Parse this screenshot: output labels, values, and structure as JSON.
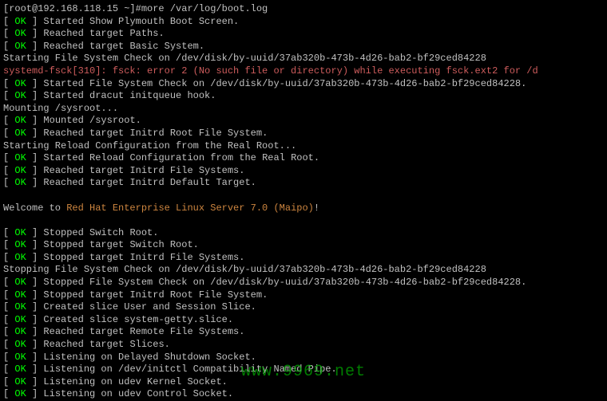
{
  "prompt": "[root@192.168.118.15 ~]#more /var/log/boot.log",
  "ok": "OK",
  "lines": {
    "l0": "Started Show Plymouth Boot Screen.",
    "l1": "Reached target Paths.",
    "l2": "Reached target Basic System.",
    "l3": "Starting File System Check on /dev/disk/by-uuid/37ab320b-473b-4d26-bab2-bf29ced84228",
    "l4": "systemd-fsck[310]: fsck: error 2 (No such file or directory) while executing fsck.ext2 for /d",
    "l5": "Started File System Check on /dev/disk/by-uuid/37ab320b-473b-4d26-bab2-bf29ced84228.",
    "l6": "Started dracut initqueue hook.",
    "l7": "Mounting /sysroot...",
    "l8": "Mounted /sysroot.",
    "l9": "Reached target Initrd Root File System.",
    "l10": "Starting Reload Configuration from the Real Root...",
    "l11": "Started Reload Configuration from the Real Root.",
    "l12": "Reached target Initrd File Systems.",
    "l13": "Reached target Initrd Default Target.",
    "welcome_prefix": "Welcome to ",
    "welcome_link": "Red Hat Enterprise Linux Server 7.0 (Maipo)",
    "welcome_suffix": "!",
    "l14": "Stopped Switch Root.",
    "l15": "Stopped target Switch Root.",
    "l16": "Stopped target Initrd File Systems.",
    "l17": "Stopping File System Check on /dev/disk/by-uuid/37ab320b-473b-4d26-bab2-bf29ced84228",
    "l18": "Stopped File System Check on /dev/disk/by-uuid/37ab320b-473b-4d26-bab2-bf29ced84228.",
    "l19": "Stopped target Initrd Root File System.",
    "l20": "Created slice User and Session Slice.",
    "l21": "Created slice system-getty.slice.",
    "l22": "Reached target Remote File Systems.",
    "l23": "Reached target Slices.",
    "l24": "Listening on Delayed Shutdown Socket.",
    "l25": "Listening on /dev/initctl Compatibility Named Pipe.",
    "l26": "Listening on udev Kernel Socket.",
    "l27": "Listening on udev Control Socket."
  },
  "watermark": "www.9969.net"
}
